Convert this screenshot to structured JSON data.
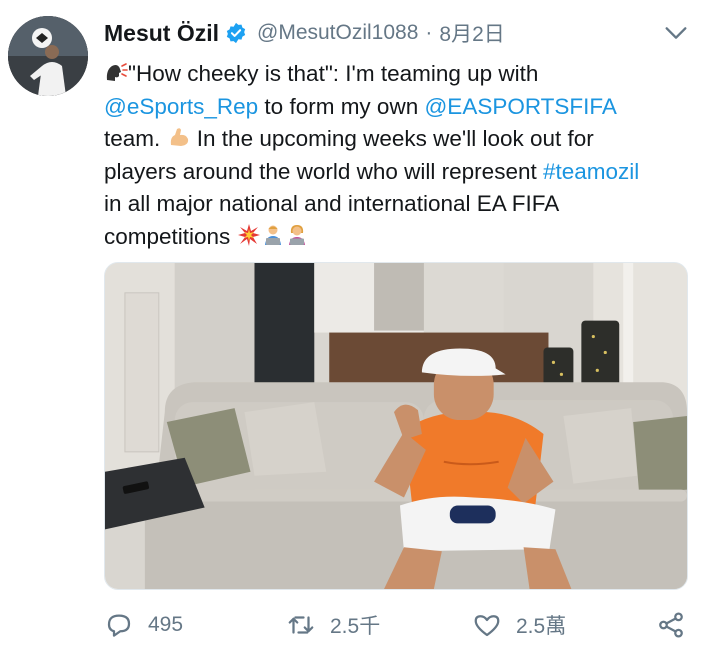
{
  "tweet": {
    "author_name": "Mesut Özil",
    "handle": "@MesutOzil1088",
    "separator": "·",
    "date": "8月2日",
    "line1": "\"How cheeky is that\": I'm teaming up with",
    "mention1": "@eSports_Rep",
    "line2_mid": " to form my own ",
    "mention2": "@EASPORTSFIFA",
    "line3_a": "team. ",
    "line3_b": " In the upcoming weeks we'll look out for",
    "line4_a": "players around the world who will represent ",
    "hashtag": "#teamozil",
    "line5": "in all major national and international EA FIFA",
    "line6": "competitions"
  },
  "icons": {
    "verified": "verified-badge-icon",
    "menu": "chevron-down-icon",
    "speaking_head": "speaking-head-emoji",
    "flexed_biceps": "flexed-biceps-emoji",
    "collision": "collision-emoji",
    "technologist_man": "man-technologist-emoji",
    "technologist_woman": "woman-technologist-emoji",
    "reply": "reply-icon",
    "retweet": "retweet-icon",
    "like": "heart-icon",
    "share": "share-icon"
  },
  "actions": {
    "replies": "495",
    "retweets": "2.5千",
    "likes": "2.5萬"
  },
  "colors": {
    "link": "#1b95e0",
    "secondary_text": "#657786",
    "verified": "#1da1f2"
  }
}
